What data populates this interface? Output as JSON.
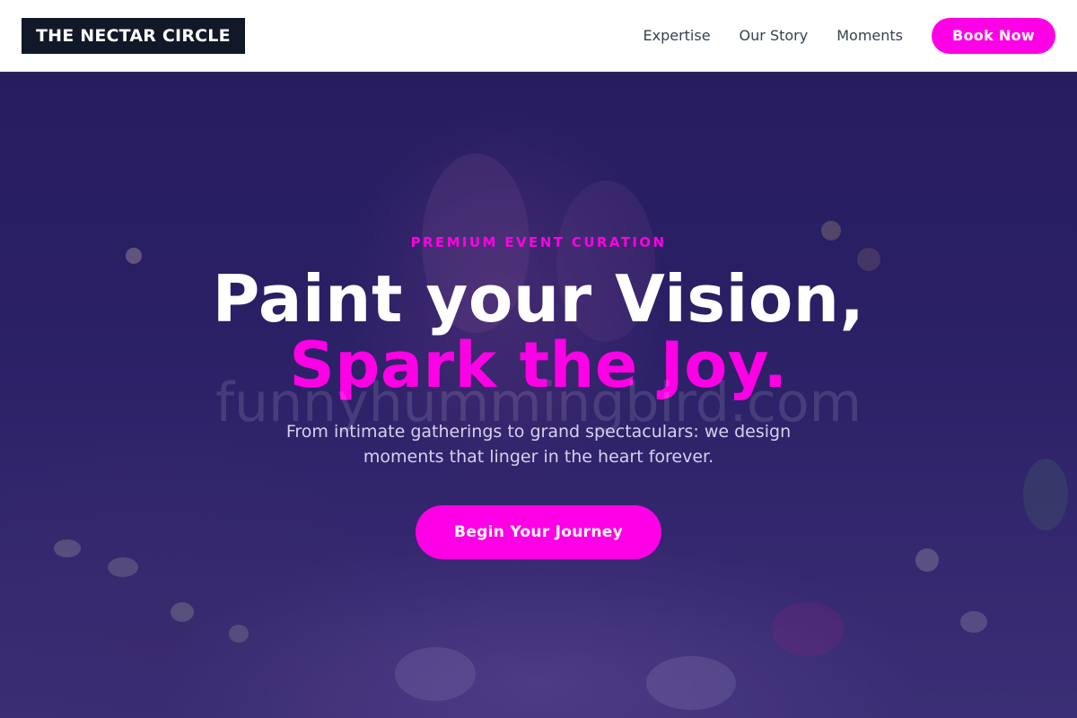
{
  "brand": {
    "logo_text": "THE NECTAR CIRCLE"
  },
  "nav": {
    "links": [
      "Expertise",
      "Our Story",
      "Moments"
    ],
    "cta_label": "Book Now"
  },
  "hero": {
    "eyebrow": "PREMIUM EVENT CURATION",
    "headline": "Paint your Vision,",
    "headline_accent": "Spark the Joy.",
    "watermark": "funnyhummingbird.com",
    "subtext": "From intimate gatherings to grand spectaculars: we design moments that linger in the heart forever.",
    "cta_label": "Begin Your Journey"
  },
  "colors": {
    "accent": "#ff00e6",
    "logo_bg": "#111827",
    "nav_text": "#374151",
    "hero_bg": "#2e2670"
  }
}
